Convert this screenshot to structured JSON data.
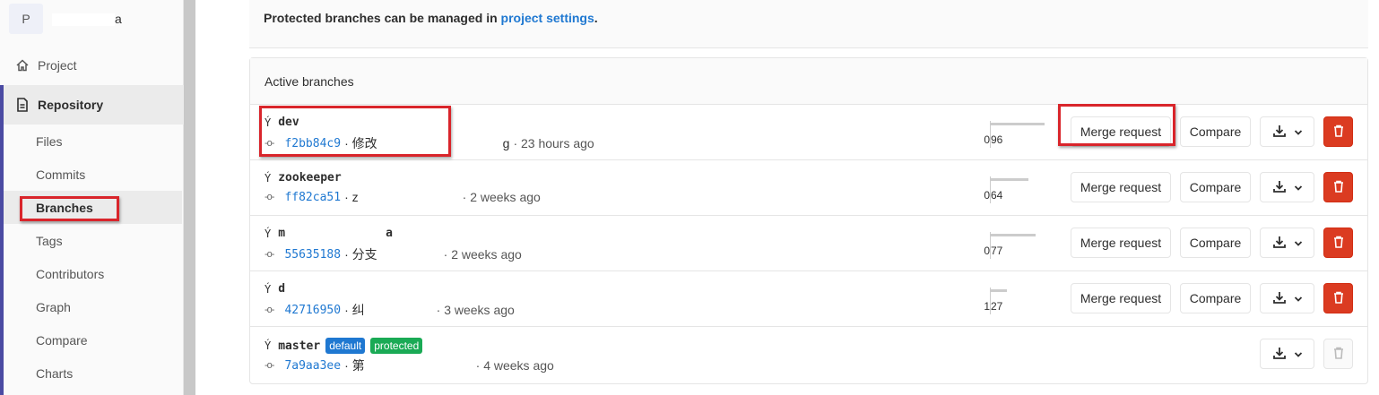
{
  "sidebar": {
    "project_initial": "P",
    "project_name_tail": "a",
    "items": {
      "project": "Project",
      "repository": "Repository"
    },
    "sub_items": [
      "Files",
      "Commits",
      "Branches",
      "Tags",
      "Contributors",
      "Graph",
      "Compare",
      "Charts"
    ],
    "active_sub": "Branches"
  },
  "notice": {
    "text": "Protected branches can be managed in ",
    "link": "project settings",
    "suffix": "."
  },
  "panel": {
    "title": "Active branches"
  },
  "buttons": {
    "merge": "Merge request",
    "compare": "Compare"
  },
  "branches": [
    {
      "name": "dev",
      "sha": "f2bb84c9",
      "msg_start": "· 修改",
      "msg_end": "g",
      "time": "· 23 hours ago",
      "behind": "0",
      "ahead": "96",
      "ahead_fraction": 0.75
    },
    {
      "name": "zookeeper",
      "sha": "ff82ca51",
      "msg_start": "· z",
      "msg_end": "",
      "time": "· 2 weeks ago",
      "behind": "0",
      "ahead": "64",
      "ahead_fraction": 0.52
    },
    {
      "name": "m",
      "name_tail": "a",
      "sha": "55635188",
      "msg_start": "· 分支",
      "msg_end": "",
      "time": "· 2 weeks ago",
      "behind": "0",
      "ahead": "77",
      "ahead_fraction": 0.62
    },
    {
      "name": "d",
      "sha": "42716950",
      "msg_start": "· 纠",
      "msg_end": "",
      "time": "· 3 weeks ago",
      "behind": "1",
      "ahead": "27",
      "ahead_fraction": 0.22
    },
    {
      "name": "master",
      "sha": "7a9aa3ee",
      "msg_start": "· 第",
      "msg_end": "",
      "time": "· 4 weeks ago",
      "badges": [
        "default",
        "protected"
      ]
    }
  ],
  "colors": {
    "accent": "#4b4ba3",
    "link": "#1f78d1",
    "danger": "#db3b21",
    "badge_default": "#1f78d1",
    "badge_protected": "#1aaa55",
    "annotation": "#d9252b"
  }
}
